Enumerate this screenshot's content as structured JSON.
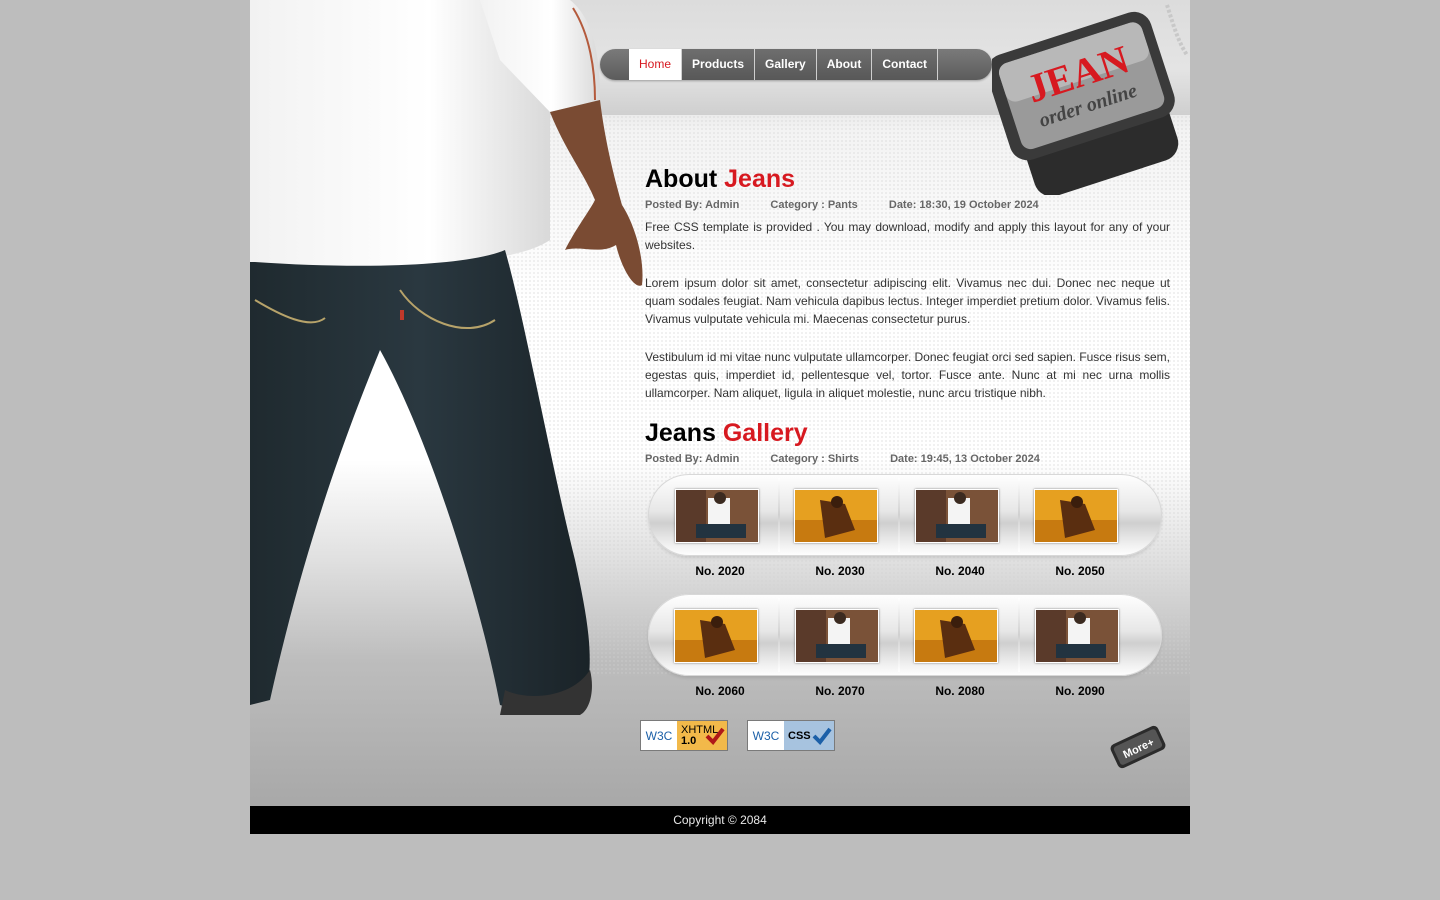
{
  "nav": {
    "items": [
      {
        "label": "Home",
        "active": true
      },
      {
        "label": "Products"
      },
      {
        "label": "Gallery"
      },
      {
        "label": "About"
      },
      {
        "label": "Contact"
      }
    ]
  },
  "logo": {
    "line1": "JEAN",
    "line2": "order online"
  },
  "about": {
    "title_main": "About",
    "title_accent": "Jeans",
    "meta": {
      "posted": "Posted By: Admin",
      "category": "Category : Pants",
      "date": "Date: 18:30, 19 October 2024"
    },
    "paragraphs": [
      "Free CSS template is provided . You may download, modify and apply this layout for any of your websites.",
      "Lorem ipsum dolor sit amet, consectetur adipiscing elit. Vivamus nec dui. Donec nec neque ut quam sodales feugiat. Nam vehicula dapibus lectus. Integer imperdiet pretium dolor. Vivamus felis. Vivamus vulputate vehicula mi. Maecenas consectetur purus.",
      "Vestibulum id mi vitae nunc vulputate ullamcorper. Donec feugiat orci sed sapien. Fusce risus sem, egestas quis, imperdiet id, pellentesque vel, tortor. Fusce ante. Nunc at mi nec urna mollis ullamcorper. Nam aliquet, ligula in aliquet molestie, nunc arcu tristique nibh."
    ]
  },
  "gallery": {
    "title_main": "Jeans",
    "title_accent": "Gallery",
    "meta": {
      "posted": "Posted By: Admin",
      "category": "Category : Shirts",
      "date": "Date: 19:45, 13 October 2024"
    },
    "row1": [
      "No. 2020",
      "No. 2030",
      "No. 2040",
      "No. 2050"
    ],
    "row2": [
      "No. 2060",
      "No. 2070",
      "No. 2080",
      "No. 2090"
    ]
  },
  "badges": {
    "w3c": "W3C",
    "xhtml_line1": "XHTML",
    "xhtml_line2": "1.0",
    "css": "CSS"
  },
  "more_label": "More+",
  "footer": {
    "copyright": "Copyright © 2084"
  }
}
